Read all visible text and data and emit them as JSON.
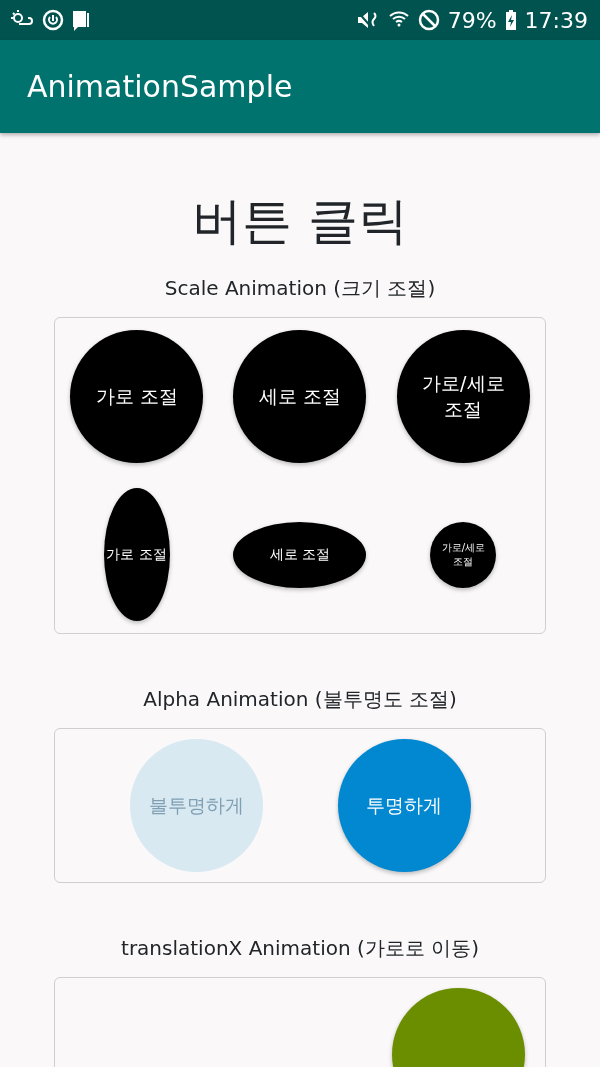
{
  "status_bar": {
    "battery": "79%",
    "time": "17:39"
  },
  "app_bar": {
    "title": "AnimationSample"
  },
  "heading": "버튼 클릭",
  "sections": [
    {
      "title": "Scale Animation (크기 조절)",
      "buttons": [
        {
          "label": "가로 조절",
          "kind": "circle",
          "color": "#000000",
          "faded": false
        },
        {
          "label": "세로 조절",
          "kind": "circle",
          "color": "#000000",
          "faded": false
        },
        {
          "label": "가로/세로\n조절",
          "kind": "circle",
          "color": "#000000",
          "faded": false
        },
        {
          "label": "가로 조절",
          "kind": "tall",
          "color": "#000000",
          "faded": false
        },
        {
          "label": "세로 조절",
          "kind": "wide",
          "color": "#000000",
          "faded": false
        },
        {
          "label": "가로/세로\n조절",
          "kind": "small",
          "color": "#000000",
          "faded": false
        }
      ]
    },
    {
      "title": "Alpha Animation (불투명도 조절)",
      "buttons": [
        {
          "label": "불투명하게",
          "kind": "circle",
          "color": "#d8e9f2",
          "faded": true
        },
        {
          "label": "투명하게",
          "kind": "circle",
          "color": "#0288d1",
          "faded": false
        }
      ]
    },
    {
      "title": "translationX Animation (가로로 이동)",
      "buttons": [
        {
          "kind": "moved",
          "color": "#6b8e00",
          "faded": false
        }
      ]
    }
  ]
}
